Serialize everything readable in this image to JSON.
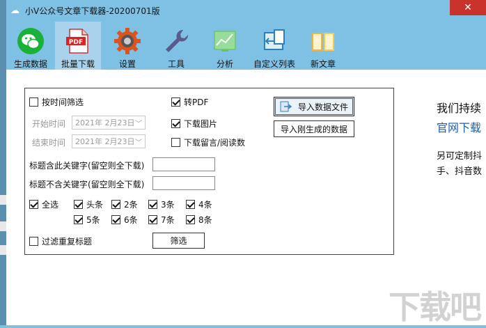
{
  "window": {
    "title": "小V公众号文章下载器-20200701版",
    "close_glyph": "✕"
  },
  "toolbar": [
    {
      "name": "gen-data",
      "label": "生成数据",
      "icon": "wechat-icon"
    },
    {
      "name": "batch-download",
      "label": "批量下载",
      "icon": "pdf-icon",
      "active": true
    },
    {
      "name": "settings",
      "label": "设置",
      "icon": "gear-icon"
    },
    {
      "name": "tools",
      "label": "工具",
      "icon": "wrench-icon"
    },
    {
      "name": "analysis",
      "label": "分析",
      "icon": "chart-icon"
    },
    {
      "name": "custom-list",
      "label": "自定义列表",
      "icon": "import-icon"
    },
    {
      "name": "new-article",
      "label": "新文章",
      "icon": "book-icon"
    }
  ],
  "filter": {
    "by_time": {
      "label": "按时间筛选",
      "checked": false
    },
    "start_label": "开始时间",
    "start_date": "2021年  2月23日",
    "end_label": "结束时间",
    "end_date": "2021年  2月23日",
    "title_include_label": "标题含此关键字(留空则全下载)",
    "title_exclude_label": "标题不含关键字(留空则全下载)",
    "select_all": {
      "label": "全选",
      "checked": true
    },
    "positions": [
      {
        "label": "头条",
        "checked": true
      },
      {
        "label": "2条",
        "checked": true
      },
      {
        "label": "3条",
        "checked": true
      },
      {
        "label": "4条",
        "checked": true
      },
      {
        "label": "5条",
        "checked": true
      },
      {
        "label": "6条",
        "checked": true
      },
      {
        "label": "7条",
        "checked": true
      },
      {
        "label": "8条",
        "checked": true
      }
    ],
    "dedupe": {
      "label": "过滤重复标题",
      "checked": false
    },
    "filter_button": "筛选"
  },
  "options": {
    "to_pdf": {
      "label": "转PDF",
      "checked": true
    },
    "download_images": {
      "label": "下载图片",
      "checked": true
    },
    "download_comments": {
      "label": "下载留言/阅读数",
      "checked": false
    }
  },
  "actions": {
    "import_file": "导入数据文件",
    "import_generated": "导入刚生成的数据"
  },
  "side_text": {
    "line1": "我们持续",
    "line2": "官网下载",
    "line3": "另可定制抖",
    "line4": "手、抖音数"
  },
  "watermark": "下载吧",
  "colors": {
    "titlebar": "#7ec1e4",
    "active_tab": "#a9d3ec",
    "link_blue": "#1a5fb4",
    "close": "#c9332b"
  }
}
